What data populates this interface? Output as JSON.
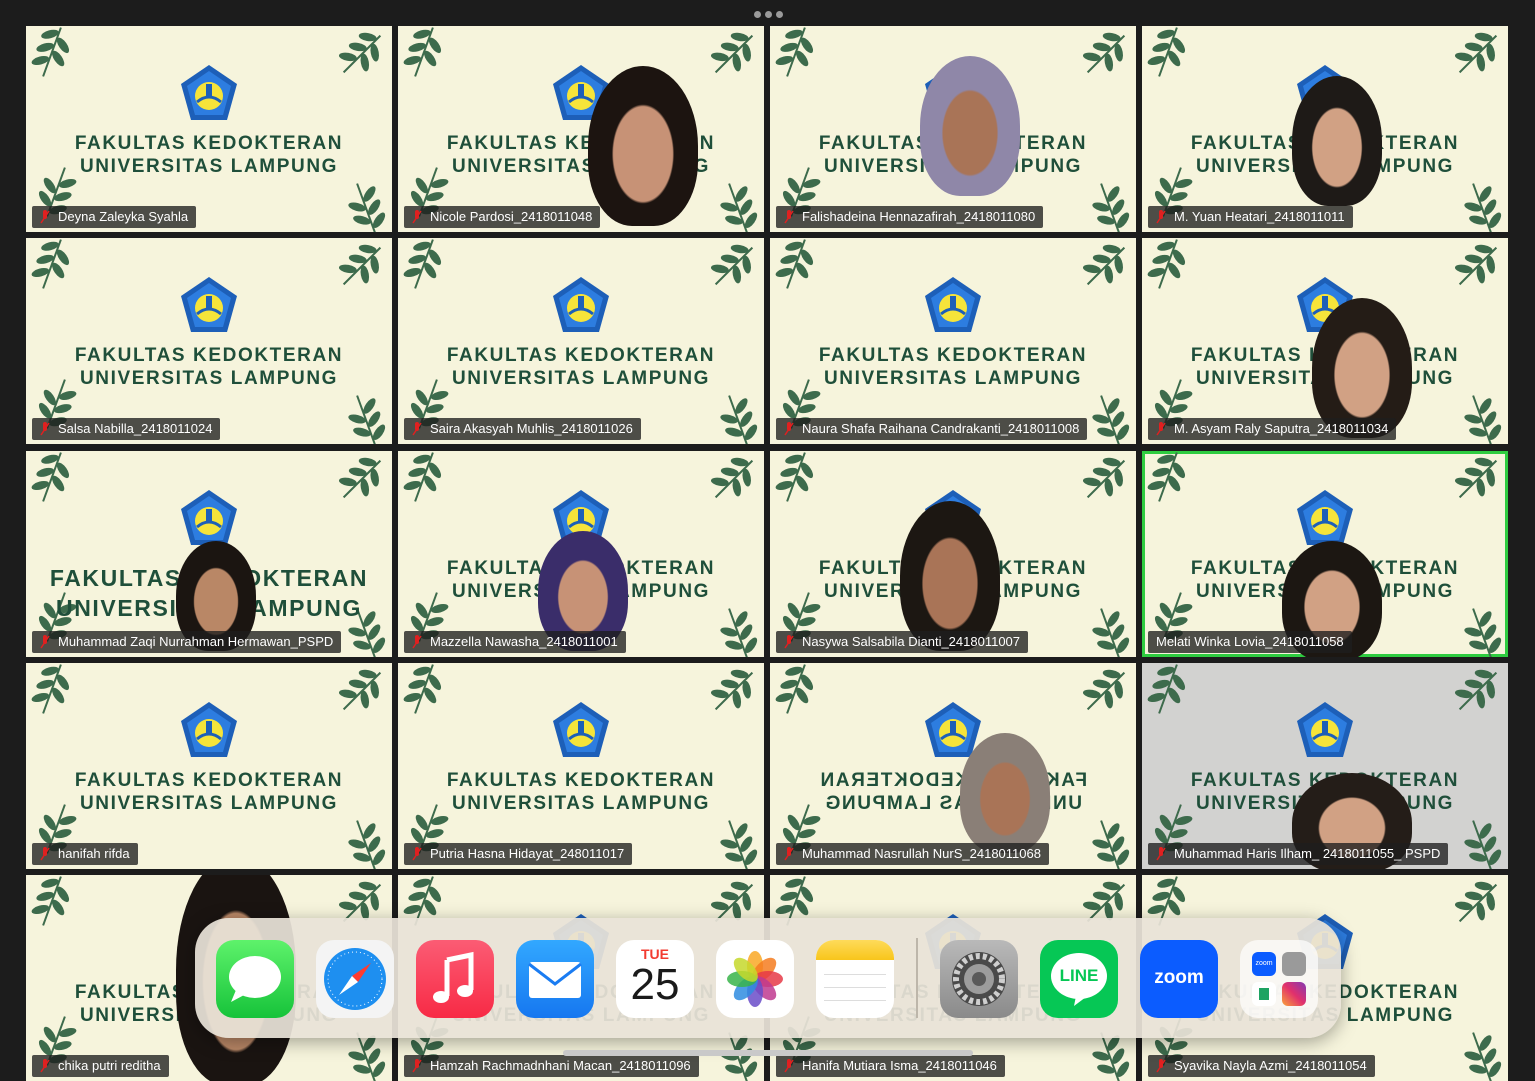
{
  "conference": {
    "background_title": [
      "FAKULTAS KEDOKTERAN",
      "UNIVERSITAS LAMPUNG"
    ],
    "participants": [
      {
        "name": "Deyna Zaleyka Syahla",
        "video": false
      },
      {
        "name": "Nicole Pardosi_2418011048",
        "video": true
      },
      {
        "name": "Falishadeina Hennazafirah_2418011080",
        "video": true
      },
      {
        "name": "M. Yuan Heatari_2418011011",
        "video": true
      },
      {
        "name": "Salsa Nabilla_2418011024",
        "video": false
      },
      {
        "name": "Saira Akasyah Muhlis_2418011026",
        "video": false
      },
      {
        "name": "Naura Shafa Raihana Candrakanti_2418011008",
        "video": false
      },
      {
        "name": "M. Asyam Raly Saputra_2418011034",
        "video": true
      },
      {
        "name": "Muhammad Zaqi Nurrahman Hermawan_PSPD",
        "video": true
      },
      {
        "name": "Mazzella Nawasha_2418011001",
        "video": true
      },
      {
        "name": "Nasywa Salsabila Dianti_2418011007",
        "video": true
      },
      {
        "name": "Melati Winka Lovia_2418011058",
        "video": true,
        "active_speaker": true,
        "muted": false
      },
      {
        "name": "hanifah rifda",
        "video": false
      },
      {
        "name": "Putria Hasna Hidayat_248011017",
        "video": false
      },
      {
        "name": "Muhammad Nasrullah NurS_2418011068",
        "video": true,
        "mirrored": true
      },
      {
        "name": "Muhammad Haris Ilham_ 2418011055_ PSPD",
        "video": true
      },
      {
        "name": "chika putri reditha",
        "video": true
      },
      {
        "name": "Hamzah Rachmadnhani Macan_2418011096",
        "video": false
      },
      {
        "name": "Hanifa Mutiara Isma_2418011046",
        "video": false
      },
      {
        "name": "Syavika Nayla Azmi_2418011054",
        "video": false
      }
    ]
  },
  "dock": {
    "calendar": {
      "day": "TUE",
      "date": "25"
    },
    "apps": [
      "Messages",
      "Safari",
      "Music",
      "Mail",
      "Calendar",
      "Photos",
      "Notes",
      "Settings",
      "LINE",
      "Zoom",
      "App Folder"
    ],
    "line_label": "LINE",
    "zoom_label": "zoom",
    "folder_zoom_label": "zoom"
  },
  "colors": {
    "accent_green": "#2ecc40",
    "background": "#1c1c1c",
    "tile_bg": "#f6f4dc"
  }
}
